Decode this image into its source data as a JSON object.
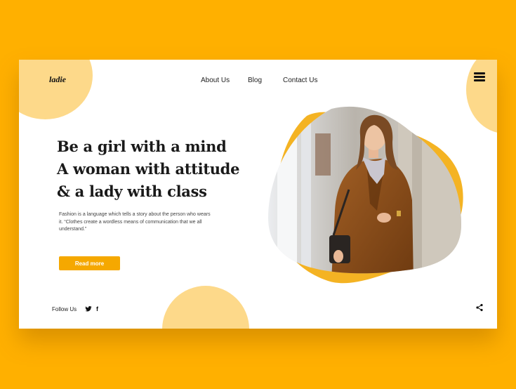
{
  "brand": {
    "logo_text": "ladie"
  },
  "nav": {
    "items": [
      {
        "label": "About Us"
      },
      {
        "label": "Blog"
      },
      {
        "label": "Contact Us"
      }
    ]
  },
  "hero": {
    "headline_lines": [
      "Be a girl with a mind",
      "A woman with attitude",
      "& a lady with class"
    ],
    "description": "Fashion is a language which tells a story about the person who wears it. “Clothes create a wordless means of communication that we all understand.”",
    "cta_label": "Read more"
  },
  "footer": {
    "follow_label": "Follow Us",
    "social": [
      "twitter-icon",
      "facebook-icon"
    ]
  },
  "icons": {
    "menu": "hamburger-menu-icon",
    "share": "share-icon"
  },
  "colors": {
    "background": "#FFB000",
    "accent": "#F5A800",
    "soft_circle": "#FDD98A",
    "card": "#FFFFFF",
    "text": "#1A1A1A"
  }
}
